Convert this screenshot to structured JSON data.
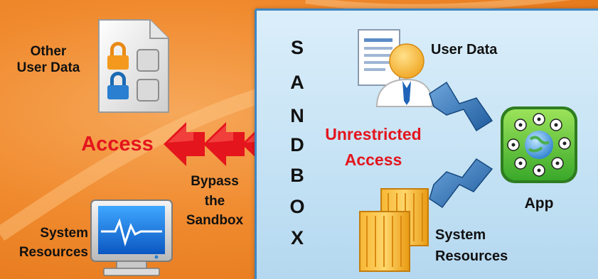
{
  "left": {
    "other_user_data": [
      "Other",
      "User Data"
    ],
    "access_label": "Access",
    "bypass_label": [
      "Bypass",
      "the",
      "Sandbox"
    ],
    "system_resources": [
      "System",
      "Resources"
    ]
  },
  "sandbox": {
    "letters": [
      "S",
      "A",
      "N",
      "D",
      "B",
      "O",
      "X"
    ],
    "user_data_label": "User Data",
    "unrestricted_access": [
      "Unrestricted",
      "Access"
    ],
    "app_label": "App",
    "system_resources": [
      "System",
      "Resources"
    ]
  },
  "colors": {
    "background": "#f08a2e",
    "sandbox_fill": "#cbe6f7",
    "sandbox_border": "#3f86c2",
    "access_red": "#e4151d",
    "connector_blue": "#2e6fb0",
    "app_green": "#54c83a"
  }
}
